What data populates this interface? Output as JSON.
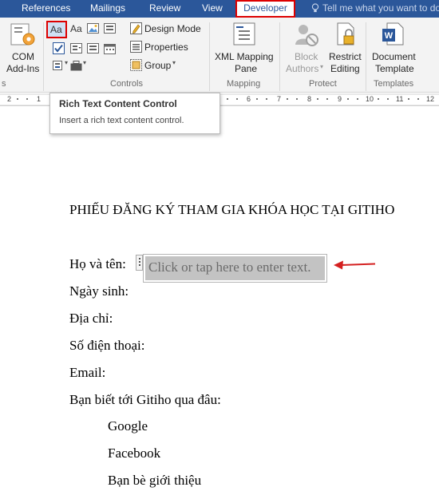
{
  "tabs": [
    {
      "label": "References"
    },
    {
      "label": "Mailings"
    },
    {
      "label": "Review"
    },
    {
      "label": "View"
    },
    {
      "label": "Developer",
      "active": true
    }
  ],
  "tellme": {
    "text": "Tell me what you want to do"
  },
  "ribbon": {
    "addins": {
      "com_label": "COM",
      "com_label2": "Add-Ins",
      "group_label": "s"
    },
    "controls": {
      "rich_text_label": "Aa",
      "plain_text_label": "Aa",
      "design_mode": "Design Mode",
      "properties": "Properties",
      "group": "Group",
      "group_label": "Controls"
    },
    "mapping": {
      "xml_line1": "XML Mapping",
      "xml_line2": "Pane",
      "group_label": "Mapping"
    },
    "protect": {
      "block_line1": "Block",
      "block_line2": "Authors",
      "restrict_line1": "Restrict",
      "restrict_line2": "Editing",
      "group_label": "Protect"
    },
    "templates": {
      "doc_line1": "Document",
      "doc_line2": "Template",
      "group_label": "Templates"
    }
  },
  "ruler": {
    "numbers": [
      "2",
      "1",
      "6",
      "7",
      "8",
      "9",
      "10",
      "11",
      "12"
    ]
  },
  "tooltip": {
    "title": "Rich Text Content Control",
    "description": "Insert a rich text content control."
  },
  "document": {
    "title": "PHIẾU ĐĂNG KÝ THAM GIA KHÓA HỌC TẠI GITIHO",
    "name_label": "Họ và tên:",
    "placeholder": "Click or tap here to enter text.",
    "birth_label": "Ngày sinh:",
    "address_label": "Địa chỉ:",
    "phone_label": "Số điện thoại:",
    "email_label": "Email:",
    "source_question": "Bạn biết tới Gitiho qua đâu:",
    "options": [
      "Google",
      "Facebook",
      "Bạn bè giới thiệu"
    ]
  },
  "colors": {
    "tab_bar": "#2b579a",
    "highlight": "#dd0000",
    "arrow": "#d42020",
    "control_fill": "#c3c3c3"
  }
}
